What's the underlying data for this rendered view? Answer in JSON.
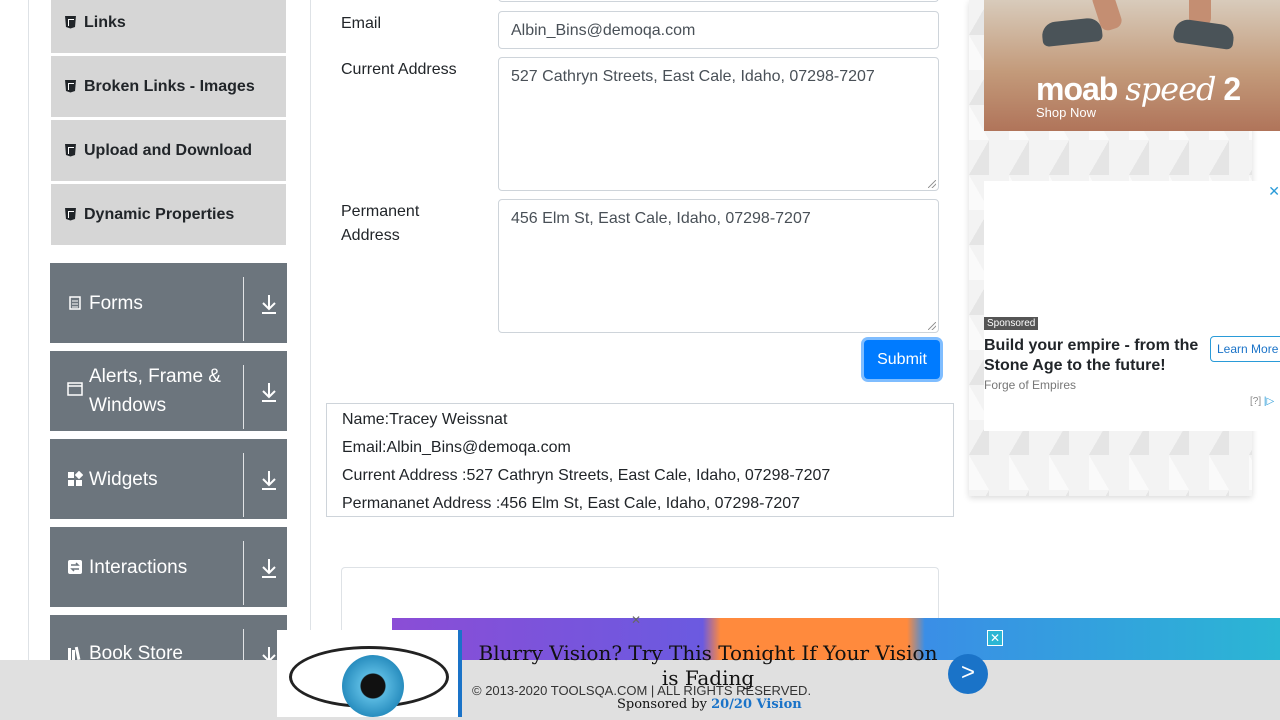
{
  "sidebar": {
    "elements_items": [
      {
        "label": "Links"
      },
      {
        "label": "Broken Links - Images"
      },
      {
        "label": "Upload and Download"
      },
      {
        "label": "Dynamic Properties"
      }
    ],
    "groups": [
      {
        "label": "Forms",
        "icon": "document-icon"
      },
      {
        "label": "Alerts, Frame & Windows",
        "icon": "window-icon"
      },
      {
        "label": "Widgets",
        "icon": "widgets-icon"
      },
      {
        "label": "Interactions",
        "icon": "interactions-icon"
      },
      {
        "label": "Book Store Application",
        "icon": "bookstore-icon"
      }
    ]
  },
  "form": {
    "email_label": "Email",
    "email_value": "Albin_Bins@demoqa.com",
    "current_address_label": "Current Address",
    "current_address_value": "527 Cathryn Streets, East Cale, Idaho, 07298-7207",
    "permanent_address_label": "Permanent Address",
    "permanent_address_value": "456 Elm St, East Cale, Idaho, 07298-7207",
    "submit_label": "Submit"
  },
  "output": {
    "name": "Name:Tracey Weissnat",
    "email": "Email:Albin_Bins@demoqa.com",
    "current_address": "Current Address :527 Cathryn Streets, East Cale, Idaho, 07298-7207",
    "permanent_address": "Permananet Address :456 Elm St, East Cale, Idaho, 07298-7207"
  },
  "ads": {
    "moab": {
      "brand": "moab",
      "brand_italic": "speed",
      "brand_num": "2",
      "cta": "Shop Now"
    },
    "empire": {
      "sponsored": "Sponsored",
      "headline": "Build your empire - from the Stone Age to the future!",
      "source": "Forge of Empires",
      "cta": "Learn More",
      "info": "[?]"
    },
    "vision": {
      "headline": "Blurry Vision? Try This Tonight If Your Vision is Fading",
      "sponsored_prefix": "Sponsored by",
      "sponsor": "20/20 Vision",
      "go": ">"
    }
  },
  "footer": {
    "copyright": "© 2013-2020 TOOLSQA.COM | ALL RIGHTS RESERVED."
  },
  "colors": {
    "primary": "#007bff",
    "group_bg": "#6c757d",
    "sub_item_bg": "#d6d6d6"
  }
}
